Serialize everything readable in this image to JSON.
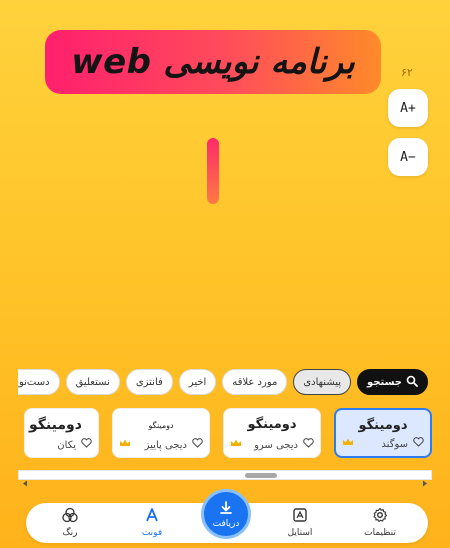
{
  "banner": {
    "text": "برنامه نویسی web"
  },
  "text_size": {
    "value": "۶۲",
    "increase_label": "A+",
    "decrease_label": "A−"
  },
  "filters": {
    "search_label": "جستجو",
    "chips": [
      {
        "label": "پیشنهادی"
      },
      {
        "label": "مورد علاقه"
      },
      {
        "label": "اخیر"
      },
      {
        "label": "فانتزی"
      },
      {
        "label": "نستعلیق"
      },
      {
        "label": "دست‌نویس"
      }
    ]
  },
  "fonts": [
    {
      "preview": "دومینگو",
      "name": "سوگند",
      "premium": true
    },
    {
      "preview": "دومینگو",
      "name": "دیجی سرو",
      "premium": true
    },
    {
      "preview": "دومینگو",
      "name": "دیجی پاییز",
      "premium": true
    },
    {
      "preview": "دومینگو",
      "name": "یکان",
      "premium": false
    }
  ],
  "bottom_nav": {
    "settings": "تنظیمات",
    "style": "استایل",
    "download": "دریافت",
    "font": "فونت",
    "color": "رنگ"
  },
  "colors": {
    "accent": "#1a73f0",
    "banner_start": "#ff1f6e",
    "banner_end": "#ff8a2a",
    "background": "#ffc52a"
  }
}
